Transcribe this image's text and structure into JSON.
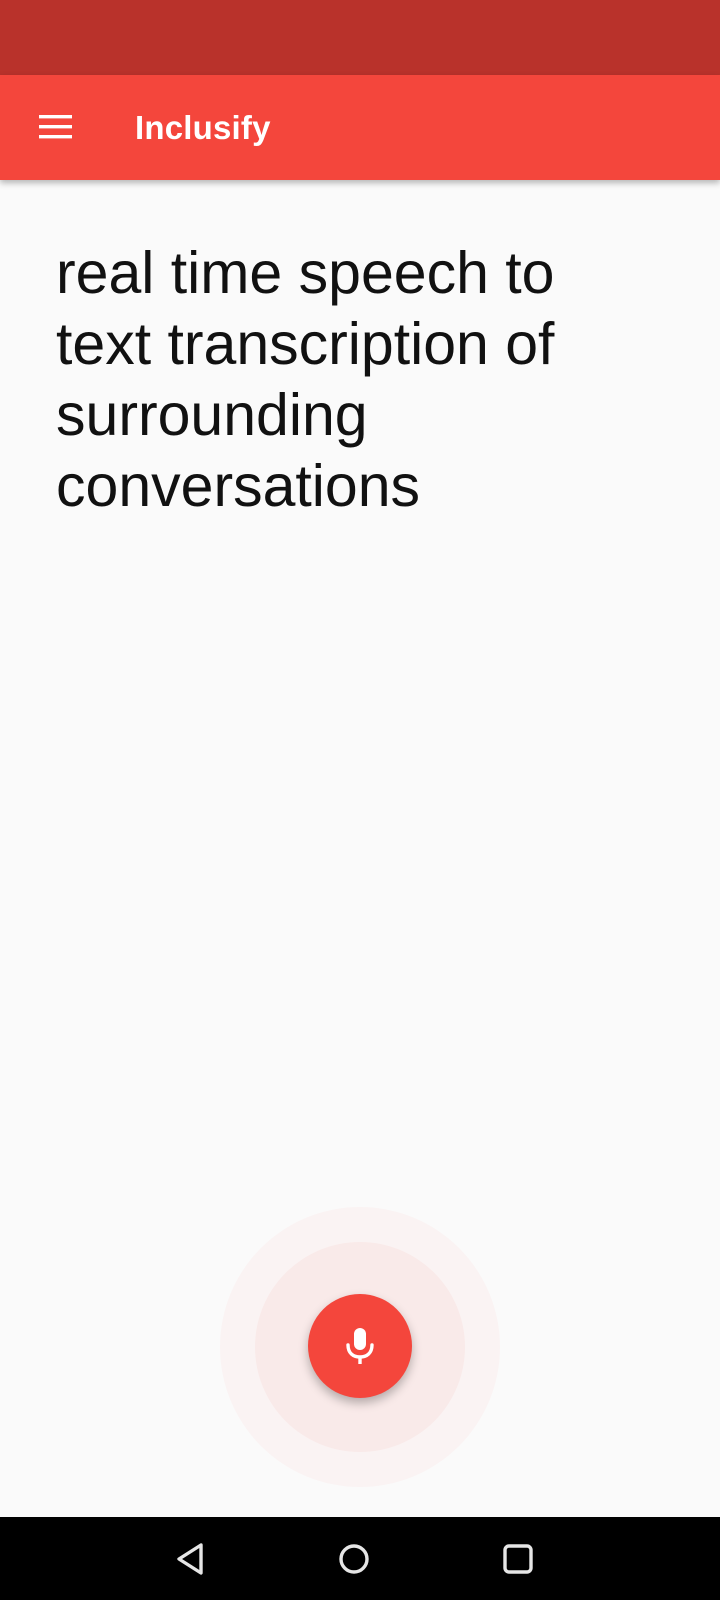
{
  "app_bar": {
    "title": "Inclusify",
    "menu_icon": "hamburger-menu-icon"
  },
  "transcript": {
    "text": "real time speech to text transcription of surrounding conversations"
  },
  "mic": {
    "icon": "microphone-icon"
  },
  "nav": {
    "back_icon": "back-triangle-icon",
    "home_icon": "home-circle-icon",
    "recents_icon": "recents-square-icon"
  },
  "colors": {
    "status_bar": "#b9322b",
    "primary": "#f4463c",
    "background": "#fafafa",
    "text": "#111111"
  }
}
